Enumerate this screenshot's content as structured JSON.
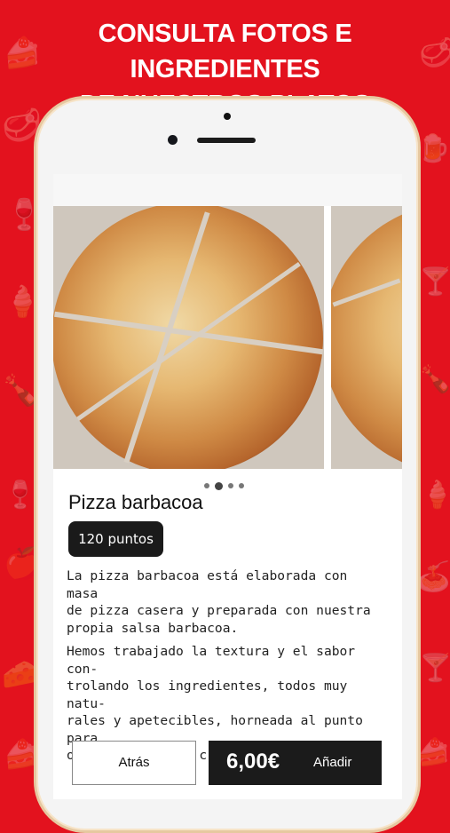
{
  "headline": {
    "line1": "CONSULTA FOTOS E INGREDIENTES",
    "line2": "DE NUESTROS PLATOS"
  },
  "product": {
    "name": "Pizza barbacoa",
    "points_badge": "120 puntos",
    "description_p1": "La pizza barbacoa está elaborada con masa\nde pizza casera y preparada con nuestra\npropia salsa barbacoa.",
    "description_p2": "Hemos trabajado la textura y el sabor con-\ntrolando los ingredientes, todos muy natu-\nrales y apetecibles, horneada al punto para\nobtener una masa crujiente y perfecta.",
    "photo_count": 4,
    "active_photo_index": 1
  },
  "actions": {
    "back_label": "Atrás",
    "price": "6,00€",
    "add_label": "Añadir"
  },
  "colors": {
    "brand_red": "#e3121e",
    "button_dark": "#1b1b1b"
  },
  "background_icons": [
    "cake-icon",
    "beer-icon",
    "steak-icon",
    "wine-glass-icon",
    "apple-icon",
    "ice-cream-icon",
    "pasta-icon",
    "cocktail-icon",
    "cheese-icon",
    "bottle-icon"
  ]
}
